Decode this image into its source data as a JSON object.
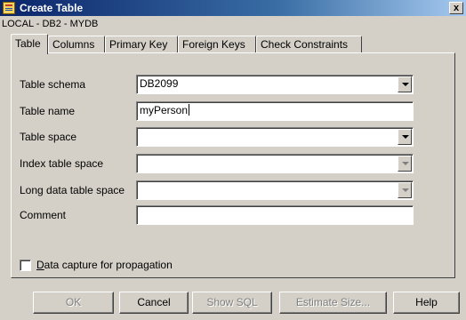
{
  "window": {
    "title": "Create Table",
    "close_glyph": "x",
    "connection": "LOCAL - DB2 - MYDB"
  },
  "tabs": [
    {
      "label": "Table"
    },
    {
      "label": "Columns"
    },
    {
      "label": "Primary Key"
    },
    {
      "label": "Foreign Keys"
    },
    {
      "label": "Check Constraints"
    }
  ],
  "form": {
    "table_schema": {
      "label": "Table schema",
      "value": "DB2099"
    },
    "table_name": {
      "label": "Table name",
      "value": "myPerson"
    },
    "table_space": {
      "label": "Table space",
      "value": ""
    },
    "index_table_space": {
      "label": "Index table space",
      "value": ""
    },
    "long_data_table_space": {
      "label": "Long data table space",
      "value": ""
    },
    "comment": {
      "label": "Comment",
      "value": ""
    },
    "data_capture": {
      "label": "Data capture for propagation",
      "checked": false
    }
  },
  "buttons": {
    "ok": "OK",
    "cancel": "Cancel",
    "show_sql": "Show SQL",
    "estimate_size": "Estimate Size...",
    "help": "Help"
  },
  "colors": {
    "titlebar_start": "#0a246a",
    "titlebar_end": "#a6caf0",
    "face": "#d4d0c8",
    "disabled_text": "#808080"
  }
}
